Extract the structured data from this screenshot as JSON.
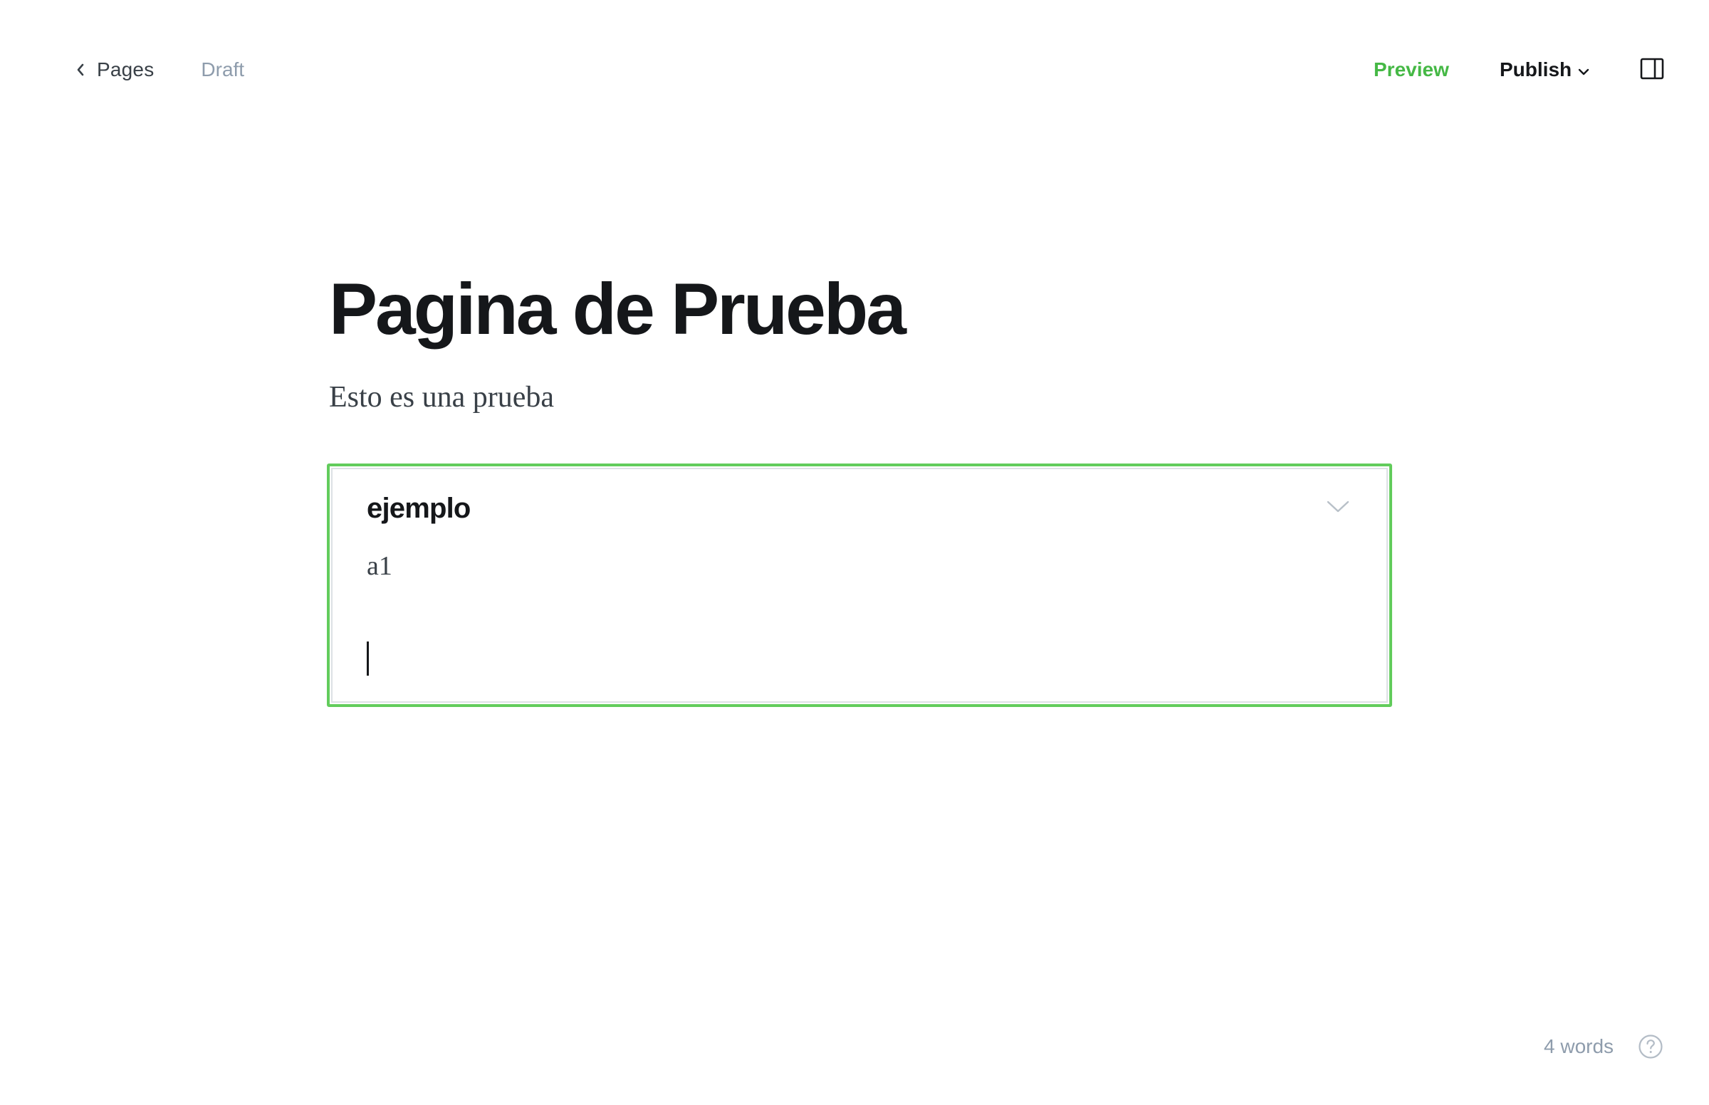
{
  "header": {
    "back_label": "Pages",
    "status": "Draft",
    "preview_label": "Preview",
    "publish_label": "Publish"
  },
  "editor": {
    "title": "Pagina de Prueba",
    "excerpt": "Esto es una prueba",
    "card": {
      "heading": "ejemplo",
      "content": "a1"
    }
  },
  "footer": {
    "word_count": "4 words"
  },
  "colors": {
    "accent_green": "#45b845",
    "card_focus_border": "#62cc5c",
    "muted_text": "#8e9cac",
    "dark_text": "#15171a"
  },
  "icons": {
    "back": "chevron-left-icon",
    "publish_dropdown": "chevron-down-icon",
    "sidebar": "sidebar-toggle-icon",
    "card_toggle": "chevron-down-icon",
    "help": "help-circle-icon"
  }
}
